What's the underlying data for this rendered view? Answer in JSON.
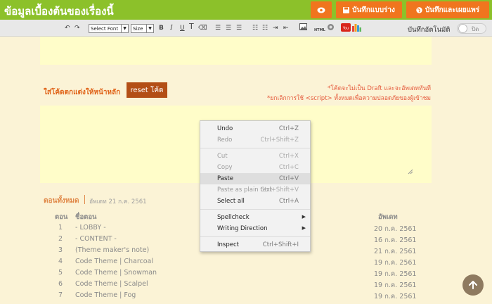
{
  "header": {
    "title": "ข้อมูลเบื้องต้นของเรื่องนี้",
    "save_draft_label": "บันทึกแบบร่าง",
    "save_publish_label": "บันทึกและเผยแพร่"
  },
  "toolbar": {
    "font_select": "Select Font",
    "size_select": "Size",
    "bold": "B",
    "italic": "I",
    "underline": "U",
    "html_label": "HTML",
    "autosave_label": "บันทึกอัตโนมัติ",
    "autosave_state": "ปิด"
  },
  "code_section": {
    "label": "ใส่โค้ดตกแต่งให้หน้าหลัก",
    "reset_label": "reset โค้ด",
    "note1": "*โค้ดจะไม่เป็น Draft และจะอัพเดททันที",
    "note2": "*ยกเลิกการใช้ <script> ทั้งหมดเพื่อความปลอดภัยของผู้เข้าชม"
  },
  "episodes": {
    "title": "ตอนทั้งหมด",
    "updated": "อัพเดท 21 ก.ค. 2561",
    "headers": {
      "num": "ตอน",
      "name": "ชื่อตอน",
      "date": "อัพเดท"
    },
    "rows": [
      {
        "num": "1",
        "name": "- LOBBY -",
        "date": "20 ก.ค. 2561"
      },
      {
        "num": "2",
        "name": "- CONTENT -",
        "date": "16 ก.ค. 2561"
      },
      {
        "num": "3",
        "name": "(Theme maker's note)",
        "date": "21 ก.ค. 2561"
      },
      {
        "num": "4",
        "name": "Code Theme | Charcoal",
        "date": "19 ก.ค. 2561"
      },
      {
        "num": "5",
        "name": "Code Theme | Snowman",
        "date": "19 ก.ค. 2561"
      },
      {
        "num": "6",
        "name": "Code Theme | Scalpel",
        "date": "19 ก.ค. 2561"
      },
      {
        "num": "7",
        "name": "Code Theme | Fog",
        "date": "19 ก.ค. 2561"
      }
    ]
  },
  "context_menu": {
    "undo": {
      "label": "Undo",
      "shortcut": "Ctrl+Z"
    },
    "redo": {
      "label": "Redo",
      "shortcut": "Ctrl+Shift+Z"
    },
    "cut": {
      "label": "Cut",
      "shortcut": "Ctrl+X"
    },
    "copy": {
      "label": "Copy",
      "shortcut": "Ctrl+C"
    },
    "paste": {
      "label": "Paste",
      "shortcut": "Ctrl+V"
    },
    "paste_plain": {
      "label": "Paste as plain text",
      "shortcut": "Ctrl+Shift+V"
    },
    "select_all": {
      "label": "Select all",
      "shortcut": "Ctrl+A"
    },
    "spellcheck": {
      "label": "Spellcheck"
    },
    "writing_direction": {
      "label": "Writing Direction"
    },
    "inspect": {
      "label": "Inspect",
      "shortcut": "Ctrl+Shift+I"
    }
  },
  "colors": {
    "header_green": "#8cc12a",
    "button_orange": "#f0751e",
    "reset_brown": "#b34f16",
    "editor_yellow": "#fffdc9",
    "page_bg": "#fbf3d6"
  },
  "icons": [
    "eye-icon",
    "save-icon",
    "globe-icon",
    "undo-icon",
    "redo-icon",
    "image-icon",
    "youtube-icon",
    "chart-icon",
    "arrow-up-icon"
  ]
}
